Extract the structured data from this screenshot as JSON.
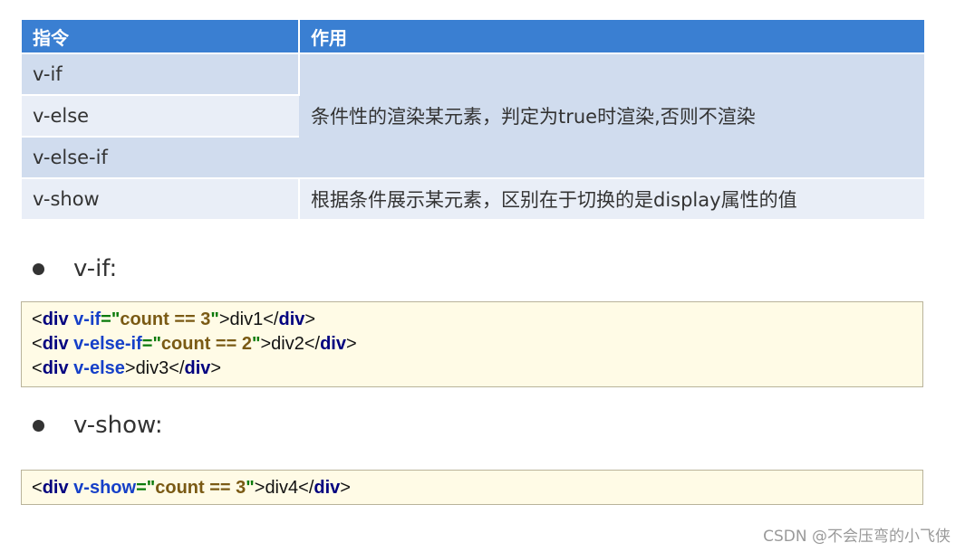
{
  "table": {
    "headers": [
      "指令",
      "作用"
    ],
    "directives": [
      "v-if",
      "v-else",
      "v-else-if",
      "v-show"
    ],
    "effect_conditional": "条件性的渲染某元素，判定为true时渲染,否则不渲染",
    "effect_show": "根据条件展示某元素，区别在于切换的是display属性的值"
  },
  "sections": {
    "vif_label": "v-if:",
    "vshow_label": "v-show:"
  },
  "code_vif": {
    "lines": [
      {
        "open": "<",
        "tag": "div",
        "attr": "v-if",
        "eq": "=",
        "q1": "\"",
        "value": "count == 3",
        "q2": "\"",
        "gt": ">",
        "text": "div1",
        "close_open": "</",
        "close_tag": "div",
        "close_gt": ">"
      },
      {
        "open": "<",
        "tag": "div",
        "attr": "v-else-if",
        "eq": "=",
        "q1": "\"",
        "value": "count == 2",
        "q2": "\"",
        "gt": ">",
        "text": "div2",
        "close_open": "</",
        "close_tag": "div",
        "close_gt": ">"
      },
      {
        "open": "<",
        "tag": "div",
        "attr": "v-else",
        "gt": ">",
        "text": "div3",
        "close_open": "</",
        "close_tag": "div",
        "close_gt": ">"
      }
    ]
  },
  "code_vshow": {
    "lines": [
      {
        "open": "<",
        "tag": "div",
        "attr": "v-show",
        "eq": "=",
        "q1": "\"",
        "value": "count == 3",
        "q2": "\"",
        "gt": ">",
        "text": "div4",
        "close_open": "</",
        "close_tag": "div",
        "close_gt": ">"
      }
    ]
  },
  "watermark": "CSDN @不会压弯的小飞侠",
  "colors": {
    "header_bg": "#3a7fd2",
    "row_dark": "#d0dcee",
    "row_light": "#e9eef7",
    "code_bg": "#fffbe6",
    "code_tag": "#00007f",
    "code_attr": "#1640c8",
    "code_string": "#0a7a0a",
    "code_value": "#7a5a14"
  }
}
